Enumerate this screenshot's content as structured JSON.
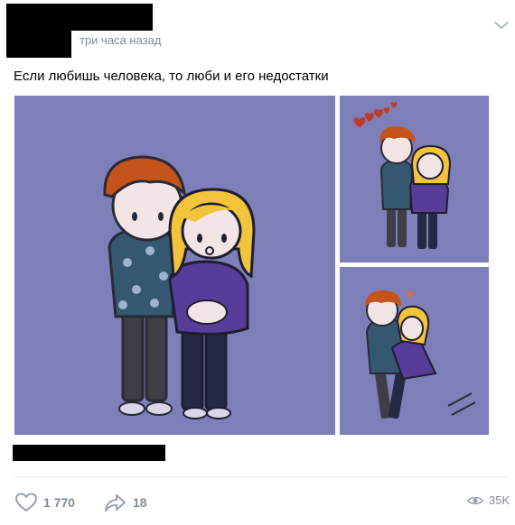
{
  "post": {
    "time": "три часа назад",
    "text": "Если любишь человека, то люби и его недостатки"
  },
  "footer": {
    "likes": "1 770",
    "shares": "18",
    "views": "35K"
  },
  "icons": {
    "menu": "chevron-down-icon",
    "like": "heart-icon",
    "share": "share-arrow-icon",
    "views": "eye-icon"
  },
  "colors": {
    "image_background": "#7e7fb8",
    "muted_text": "#818c99"
  }
}
